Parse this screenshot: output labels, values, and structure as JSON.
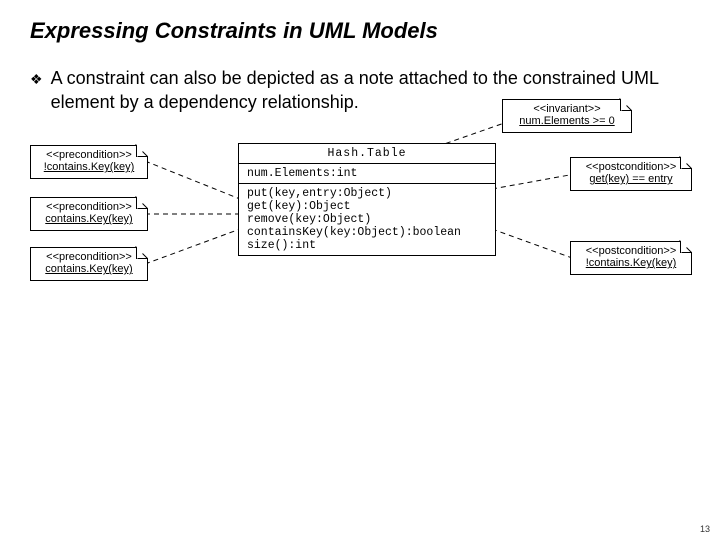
{
  "title": "Expressing Constraints in UML Models",
  "bullet": "A constraint can also be depicted as a note attached to the constrained UML element by a dependency relationship.",
  "notes": {
    "invariant": {
      "stereo": "<<invariant>>",
      "text": "num.Elements >= 0"
    },
    "pre1": {
      "stereo": "<<precondition>>",
      "text": "!contains.Key(key)"
    },
    "pre2": {
      "stereo": "<<precondition>>",
      "text": "contains.Key(key)"
    },
    "pre3": {
      "stereo": "<<precondition>>",
      "text": "contains.Key(key)"
    },
    "post1": {
      "stereo": "<<postcondition>>",
      "text": "get(key) == entry"
    },
    "post2": {
      "stereo": "<<postcondition>>",
      "text": "!contains.Key(key)"
    }
  },
  "class": {
    "name": "Hash.Table",
    "attrs": "num.Elements:int",
    "ops": "put(key,entry:Object)\nget(key):Object\nremove(key:Object)\ncontainsKey(key:Object):boolean\nsize():int"
  },
  "page": "13"
}
